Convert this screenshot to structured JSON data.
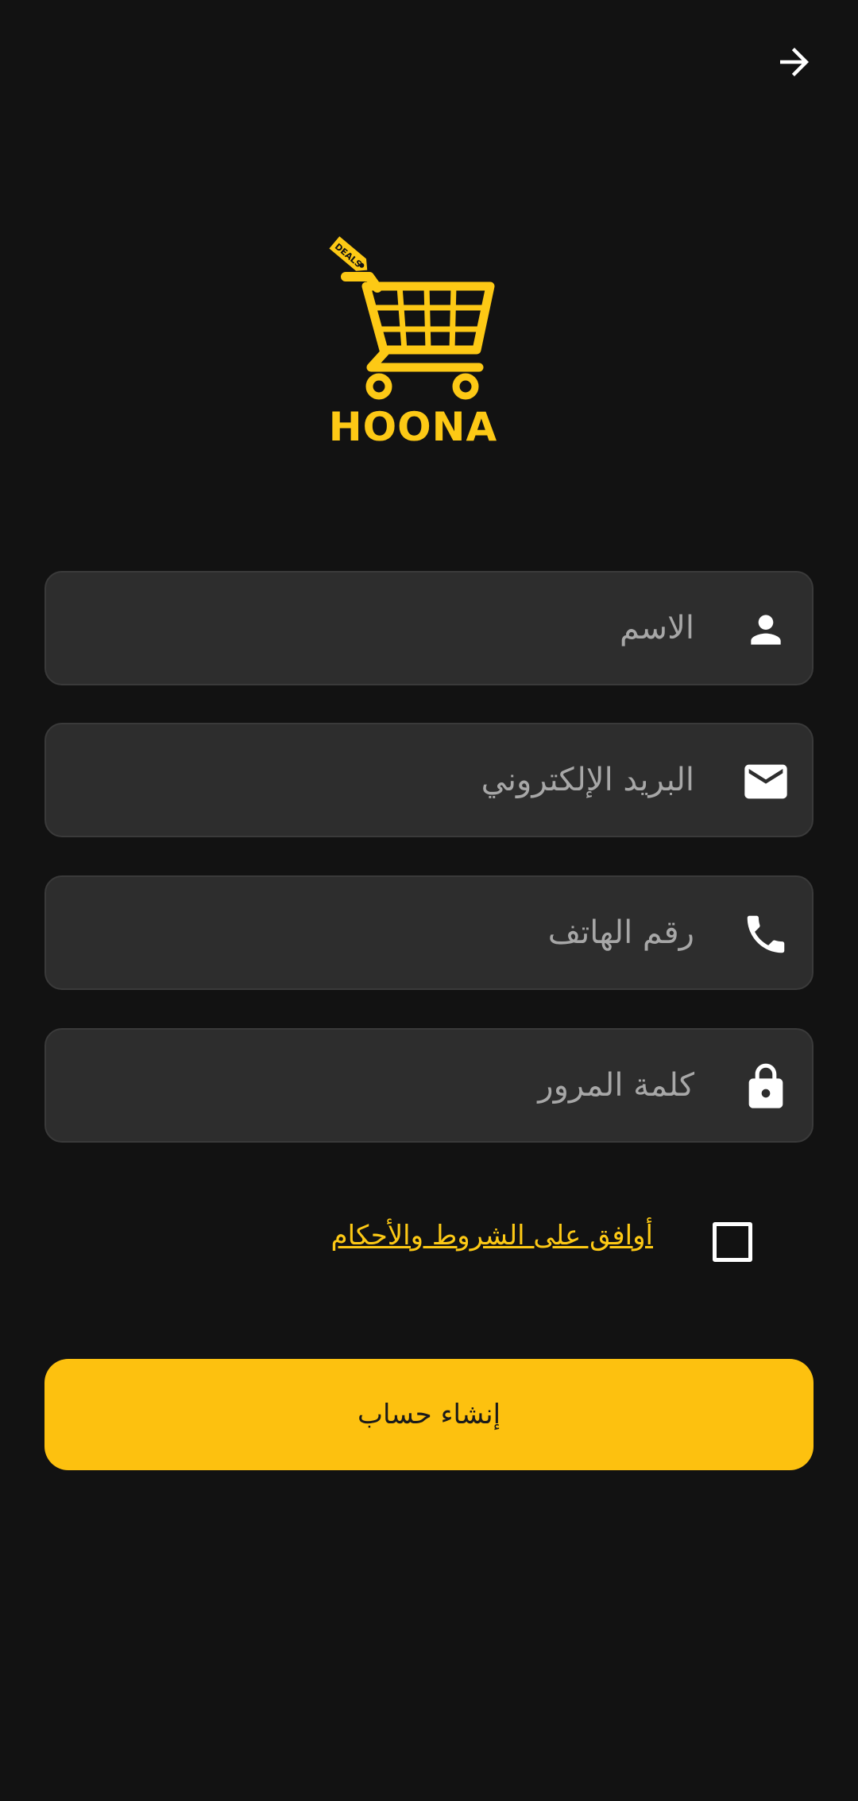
{
  "header": {
    "back_icon": "arrow-right-icon"
  },
  "logo": {
    "brand_name": "HOONA",
    "tag_text": "DEALS",
    "icon": "shopping-cart-icon"
  },
  "form": {
    "name_field": {
      "placeholder": "الاسم",
      "value": "",
      "icon": "person-icon"
    },
    "email_field": {
      "placeholder": "البريد الإلكتروني",
      "value": "",
      "icon": "envelope-icon"
    },
    "phone_field": {
      "placeholder": "رقم الهاتف",
      "value": "",
      "icon": "phone-icon"
    },
    "password_field": {
      "placeholder": "كلمة المرور",
      "value": "",
      "icon": "lock-icon"
    },
    "terms_label": "أوافق على الشروط والأحكام",
    "terms_checked": false,
    "submit_label": "إنشاء حساب"
  },
  "colors": {
    "background": "#121212",
    "field_background": "#2D2D2D",
    "accent": "#FDC10F",
    "placeholder_text": "#A7A7A7",
    "icon": "#FFFFFF"
  }
}
